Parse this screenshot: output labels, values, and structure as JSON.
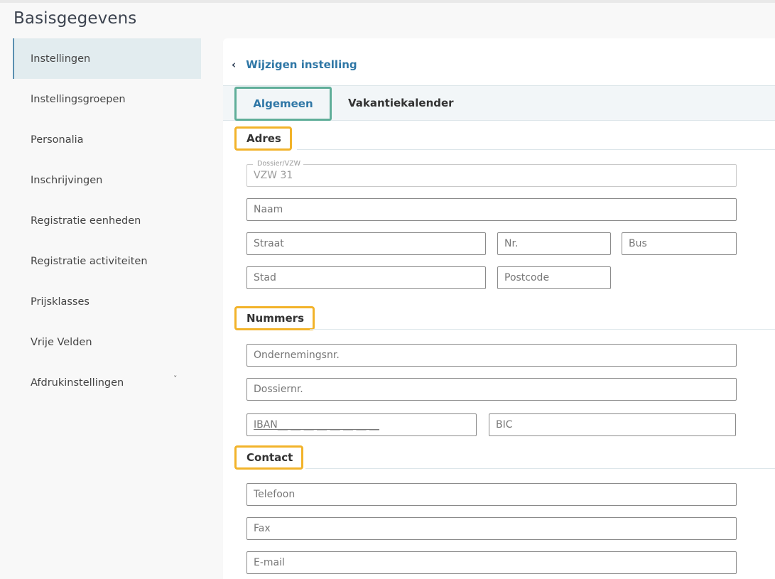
{
  "page": {
    "title": "Basisgegevens"
  },
  "sidebar": {
    "items": [
      {
        "label": "Instellingen",
        "active": true
      },
      {
        "label": "Instellingsgroepen"
      },
      {
        "label": "Personalia"
      },
      {
        "label": "Inschrijvingen"
      },
      {
        "label": "Registratie eenheden"
      },
      {
        "label": "Registratie activiteiten"
      },
      {
        "label": "Prijsklasses"
      },
      {
        "label": "Vrije Velden"
      },
      {
        "label": "Afdrukinstellingen",
        "expand_icon": "ˇ"
      }
    ]
  },
  "panel": {
    "back_icon": "‹",
    "back_label": "Wijzigen instelling",
    "tabs": [
      {
        "label": "Algemeen",
        "active": true
      },
      {
        "label": "Vakantiekalender"
      }
    ],
    "sections": {
      "address": {
        "title": "Adres",
        "dossier": {
          "label": "Dossier/VZW",
          "value": "VZW 31"
        },
        "name_placeholder": "Naam",
        "street_placeholder": "Straat",
        "number_placeholder": "Nr.",
        "bus_placeholder": "Bus",
        "city_placeholder": "Stad",
        "postcode_placeholder": "Postcode"
      },
      "numbers": {
        "title": "Nummers",
        "company_placeholder": "Ondernemingsnr.",
        "dossier_placeholder": "Dossiernr.",
        "iban_placeholder": "IBAN__ __ __ __ __ __ __ __",
        "bic_placeholder": "BIC"
      },
      "contact": {
        "title": "Contact",
        "phone_placeholder": "Telefoon",
        "fax_placeholder": "Fax",
        "email_placeholder": "E-mail"
      }
    }
  },
  "colors": {
    "accent_blue": "#2f77a6",
    "tab_highlight": "#5fae99",
    "section_highlight": "#f2b32a",
    "active_sidebar_bg": "#e2ecef"
  }
}
